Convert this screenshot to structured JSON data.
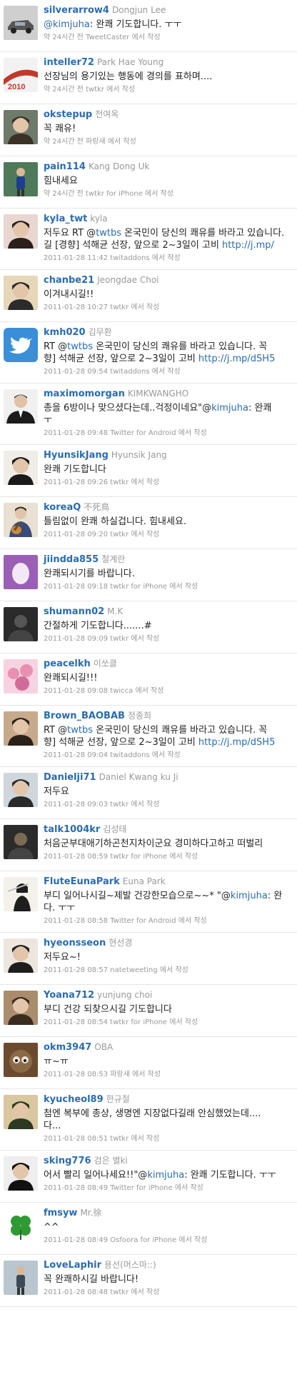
{
  "tweets": [
    {
      "screen_name": "silverarrow4",
      "real_name": "Dongjun Lee",
      "segments": [
        {
          "t": "@kimjuha",
          "c": "m"
        },
        {
          "t": ": 완쾌 기도합니다. ㅜㅜ"
        }
      ],
      "meta": "약 24시간 전 TweetCaster 에서 작성",
      "avatar": "car",
      "colors": [
        "#cfcfcf",
        "#555555"
      ]
    },
    {
      "screen_name": "inteller72",
      "real_name": "Park Hae Young",
      "segments": [
        {
          "t": "선장님의 용기있는 행동에 경의를 표하며...."
        }
      ],
      "meta": "약 24시간 전 twtkr 에서 작성",
      "avatar": "stripe",
      "colors": [
        "#f2f2f2",
        "#c0392b"
      ]
    },
    {
      "screen_name": "okstepup",
      "real_name": "전여옥",
      "segments": [
        {
          "t": "꼭 쾌유!"
        }
      ],
      "meta": "약 24시간 전 파랑새 에서 작성",
      "avatar": "face",
      "colors": [
        "#6e7a6a",
        "#3b3226"
      ]
    },
    {
      "screen_name": "pain114",
      "real_name": "Kang Dong Uk",
      "segments": [
        {
          "t": "힘내세요"
        }
      ],
      "meta": "약 24시간 전 twtkr for iPhone 에서 작성",
      "avatar": "person",
      "colors": [
        "#4f7a5a",
        "#1f3f8a"
      ]
    },
    {
      "screen_name": "kyla_twt",
      "real_name": "kyla",
      "segments": [
        {
          "t": "저두요 RT @"
        },
        {
          "t": "twtbs",
          "c": "m"
        },
        {
          "t": " 온국민이 당신의 쾌유를 바라고 있습니다."
        }
      ],
      "text2": [
        {
          "t": "길 [경향] 석해균 선장, 앞으로 2~3일이 고비 "
        },
        {
          "t": "http://j.mp/",
          "c": "l"
        }
      ],
      "meta": "2011-01-28 11:42 twitaddons 에서 작성",
      "avatar": "face",
      "colors": [
        "#e9d6d0",
        "#2b1f1c"
      ],
      "tall": true
    },
    {
      "screen_name": "chanbe21",
      "real_name": "Jeongdae Choi",
      "segments": [
        {
          "t": "이겨내시길!!"
        }
      ],
      "meta": "2011-01-28 10:27 twtkr 에서 작성",
      "avatar": "face",
      "colors": [
        "#e6d7b9",
        "#2b2b2b"
      ]
    },
    {
      "screen_name": "kmh020",
      "real_name": "김무환",
      "segments": [
        {
          "t": "RT @"
        },
        {
          "t": "twtbs",
          "c": "m"
        },
        {
          "t": " 온국민이 당신의 쾌유를 바라고 있습니다. 꼭"
        }
      ],
      "text2": [
        {
          "t": "향] 석해균 선장, 앞으로 2~3일이 고비 "
        },
        {
          "t": "http://j.mp/dSH5",
          "c": "l"
        }
      ],
      "meta": "2011-01-28 09:54 twitaddons 에서 작성",
      "avatar": "bird",
      "colors": [
        "#3a8fd6",
        "#ffffff"
      ],
      "tall": true
    },
    {
      "screen_name": "maximomorgan",
      "real_name": "KIMKWANGHO",
      "segments": [
        {
          "t": "총을 6방이나 맞으셨다는데..걱정이네요\"@"
        },
        {
          "t": "kimjuha",
          "c": "m"
        },
        {
          "t": ": 완쾌"
        }
      ],
      "text2": [
        {
          "t": "ㅜ"
        }
      ],
      "meta": "2011-01-28 09:48 Twitter for Android 에서 작성",
      "avatar": "suit",
      "colors": [
        "#f0f0f0",
        "#1c1c1c"
      ],
      "tall": true
    },
    {
      "screen_name": "HyunsikJang",
      "real_name": "Hyunsik Jang",
      "segments": [
        {
          "t": "완쾌 기도합니다"
        }
      ],
      "meta": "2011-01-28 09:26 twtkr 에서 작성",
      "avatar": "face",
      "colors": [
        "#f0ece6",
        "#1a1a1a"
      ]
    },
    {
      "screen_name": "koreaQ",
      "real_name": "不死鳥",
      "segments": [
        {
          "t": "틀림없이 완쾌 하실겁니다. 힘내세요."
        }
      ],
      "meta": "2011-01-28 09:20 twtkr 에서 작성",
      "avatar": "guitar",
      "colors": [
        "#e8e0d2",
        "#2f2a22"
      ]
    },
    {
      "screen_name": "jiindda855",
      "real_name": "철계란",
      "segments": [
        {
          "t": "완쾌되시기를 바랍니다."
        }
      ],
      "meta": "2011-01-28 09:18 twtkr for iPhone 에서 작성",
      "avatar": "egg",
      "colors": [
        "#9b5fb5",
        "#f3e8f6"
      ]
    },
    {
      "screen_name": "shumann02",
      "real_name": "M.K",
      "segments": [
        {
          "t": "간절하게 기도합니다.......#"
        }
      ],
      "meta": "2011-01-28 09:09 twtkr 에서 작성",
      "avatar": "dark",
      "colors": [
        "#2a2a2a",
        "#555555"
      ]
    },
    {
      "screen_name": "peacelkh",
      "real_name": "이쏘클",
      "segments": [
        {
          "t": "완쾌되시길!!!"
        }
      ],
      "meta": "2011-01-28 09:08 twicca 에서 작성",
      "avatar": "pink",
      "colors": [
        "#e98fb2",
        "#f7d3e1"
      ]
    },
    {
      "screen_name": "Brown_BAOBAB",
      "real_name": "정종희",
      "segments": [
        {
          "t": "RT @"
        },
        {
          "t": "twtbs",
          "c": "m"
        },
        {
          "t": " 온국민이 당신의 쾌유를 바라고 있습니다. 꼭"
        }
      ],
      "text2": [
        {
          "t": "향] 석해균 선장, 앞으로 2~3일이 고비 "
        },
        {
          "t": "http://j.mp/dSH5",
          "c": "l"
        }
      ],
      "meta": "2011-01-28 09:04 twitaddons 에서 작성",
      "avatar": "face",
      "colors": [
        "#c7a98c",
        "#2a2118"
      ],
      "tall": true
    },
    {
      "screen_name": "Danielji71",
      "real_name": "Daniel Kwang ku Ji",
      "segments": [
        {
          "t": "저두요"
        }
      ],
      "meta": "2011-01-28 09:03 twtkr 에서 작성",
      "avatar": "face",
      "colors": [
        "#cfd6dc",
        "#2a2a2a"
      ]
    },
    {
      "screen_name": "talk1004kr",
      "real_name": "김성태",
      "segments": [
        {
          "t": "처음군부대애기하곤천지차이군요 경미하다고하고 떠벌리"
        }
      ],
      "meta": "2011-01-28 08:59 twtkr for iPhone 에서 작성",
      "avatar": "dark",
      "colors": [
        "#2b2b2b",
        "#7a6a55"
      ]
    },
    {
      "screen_name": "FluteEunaPark",
      "real_name": "Euna Park",
      "segments": [
        {
          "t": "부디 일어나시길~제발 건강한모습으로~~* \"@"
        },
        {
          "t": "kimjuha",
          "c": "m"
        },
        {
          "t": ": 완"
        }
      ],
      "text2": [
        {
          "t": "다. ㅜㅜ"
        }
      ],
      "meta": "2011-01-28 08:58 Twitter for Android 에서 작성",
      "avatar": "flute",
      "colors": [
        "#f4f1ea",
        "#1e1e1e"
      ],
      "tall": true
    },
    {
      "screen_name": "hyeonsseon",
      "real_name": "현선경",
      "segments": [
        {
          "t": "저두요~!"
        }
      ],
      "meta": "2011-01-28 08:57 natetweeting 에서 작성",
      "avatar": "face",
      "colors": [
        "#ede6df",
        "#1d1d1d"
      ]
    },
    {
      "screen_name": "Yoana712",
      "real_name": "yunjung choi",
      "segments": [
        {
          "t": "부디 건강 되찾으시길 기도합니다"
        }
      ],
      "meta": "2011-01-28 08:54 twtkr for iPhone 에서 작성",
      "avatar": "face",
      "colors": [
        "#a98d6d",
        "#3a2c1f"
      ]
    },
    {
      "screen_name": "okm3947",
      "real_name": "OBA",
      "segments": [
        {
          "t": "ㅠ~ㅠ"
        }
      ],
      "meta": "2011-01-28 08:53 파랑새 에서 작성",
      "avatar": "creature",
      "colors": [
        "#6b4a2f",
        "#e9e3d8"
      ]
    },
    {
      "screen_name": "kyucheol89",
      "real_name": "한규철",
      "segments": [
        {
          "t": "첨엔 복부에 총상, 생명엔 지장없다길래 안심했었는데...."
        }
      ],
      "text2": [
        {
          "t": "다..."
        }
      ],
      "meta": "2011-01-28 08:51 twtkr 에서 작성",
      "avatar": "face",
      "colors": [
        "#d9c79f",
        "#2d3a22"
      ],
      "tall": true
    },
    {
      "screen_name": "sking776",
      "real_name": "검은 별ki",
      "segments": [
        {
          "t": "어서 빨리 일어나세요!!\"@"
        },
        {
          "t": "kimjuha",
          "c": "m"
        },
        {
          "t": ": 완쾌 기도합니다. ㅜㅜ"
        }
      ],
      "meta": "2011-01-28 08:49 Twitter for iPhone 에서 작성",
      "avatar": "face",
      "colors": [
        "#eeeeee",
        "#111111"
      ]
    },
    {
      "screen_name": "fmsyw",
      "real_name": "Mr.徐",
      "segments": [
        {
          "t": "^^"
        }
      ],
      "meta": "2011-01-28 08:49 Osfoora for iPhone 에서 작성",
      "avatar": "clover",
      "colors": [
        "#ffffff",
        "#2f9a33"
      ]
    },
    {
      "screen_name": "LoveLaphir",
      "real_name": "용선(머스마::)",
      "segments": [
        {
          "t": "꼭 완쾌하시길 바랍니다!"
        }
      ],
      "meta": "2011-01-28 08:48 twtkr 에서 작성",
      "avatar": "person",
      "colors": [
        "#b9c6cf",
        "#3b4a55"
      ]
    }
  ]
}
